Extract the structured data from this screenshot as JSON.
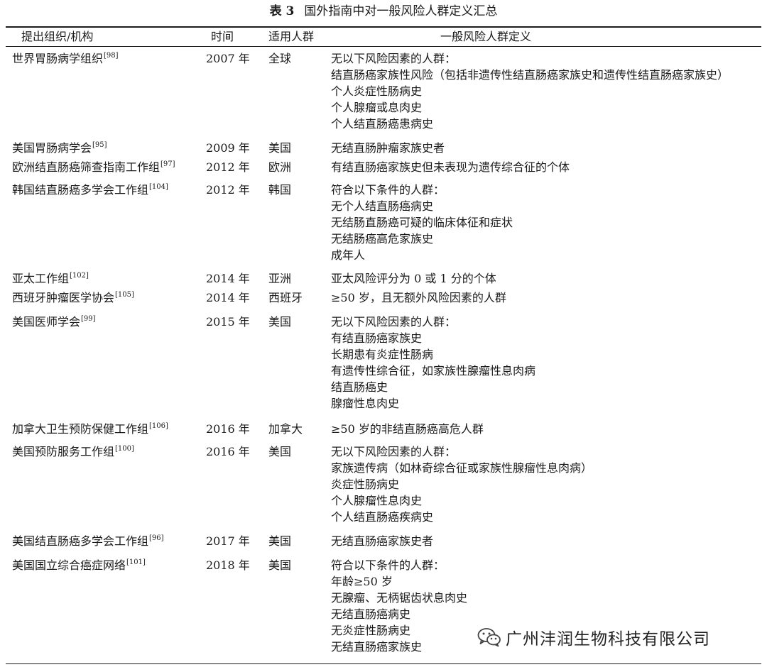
{
  "table": {
    "label": "表 3",
    "caption": "国外指南中对一般风险人群定义汇总",
    "headers": {
      "org": "提出组织/机构",
      "year": "时间",
      "scope": "适用人群",
      "definition": "一般风险人群定义"
    },
    "rows": [
      {
        "org": "世界胃肠病学组织",
        "ref": "[98]",
        "year": "2007 年",
        "scope": "全球",
        "defs": [
          "无以下风险因素的人群：",
          "结直肠癌家族性风险（包括非遗传性结直肠癌家族史和遗传性结直肠癌家族史）",
          "个人炎症性肠病史",
          "个人腺瘤或息肉史",
          "个人结直肠癌患病史"
        ]
      },
      {
        "org": "美国胃肠病学会",
        "ref": "[95]",
        "year": "2009 年",
        "scope": "美国",
        "defs": [
          "无结直肠肿瘤家族史者"
        ]
      },
      {
        "org": "欧洲结直肠癌筛查指南工作组",
        "ref": "[97]",
        "year": "2012 年",
        "scope": "欧洲",
        "defs": [
          "有结直肠癌家族史但未表现为遗传综合征的个体"
        ]
      },
      {
        "org": "韩国结直肠癌多学会工作组",
        "ref": "[104]",
        "year": "2012 年",
        "scope": "韩国",
        "defs": [
          "符合以下条件的人群：",
          "无个人结直肠癌病史",
          "无结肠直肠癌可疑的临床体征和症状",
          "无结肠癌高危家族史",
          "成年人"
        ]
      },
      {
        "org": "亚太工作组",
        "ref": "[102]",
        "year": "2014 年",
        "scope": "亚洲",
        "defs": [
          "亚太风险评分为 0 或 1 分的个体"
        ]
      },
      {
        "org": "西班牙肿瘤医学协会",
        "ref": "[105]",
        "year": "2014 年",
        "scope": "西班牙",
        "defs": [
          "≥50 岁，且无额外风险因素的人群"
        ]
      },
      {
        "org": "美国医师学会",
        "ref": "[99]",
        "year": "2015 年",
        "scope": "美国",
        "defs": [
          "无以下风险因素的人群：",
          "有结直肠癌家族史",
          "长期患有炎症性肠病",
          "有遗传性综合征，如家族性腺瘤性息肉病",
          "结直肠癌史",
          "腺瘤性息肉史"
        ]
      },
      {
        "org": "加拿大卫生预防保健工作组",
        "ref": "[106]",
        "year": "2016 年",
        "scope": "加拿大",
        "defs": [
          "≥50 岁的非结直肠癌高危人群"
        ]
      },
      {
        "org": "美国预防服务工作组",
        "ref": "[100]",
        "year": "2016 年",
        "scope": "美国",
        "defs": [
          "无以下风险因素的人群：",
          "家族遗传病（如林奇综合征或家族性腺瘤性息肉病）",
          "炎症性肠病史",
          "个人腺瘤性息肉史",
          "个人结直肠癌疾病史"
        ]
      },
      {
        "org": "美国结直肠癌多学会工作组",
        "ref": "[96]",
        "year": "2017 年",
        "scope": "美国",
        "defs": [
          "无结直肠癌家族史者"
        ]
      },
      {
        "org": "美国国立综合癌症网络",
        "ref": "[101]",
        "year": "2018 年",
        "scope": "美国",
        "defs": [
          "符合以下条件的人群：",
          "年龄≥50 岁",
          "无腺瘤、无柄锯齿状息肉史",
          "无结直肠癌病史",
          "无炎症性肠病史",
          "无结直肠癌家族史"
        ]
      }
    ]
  },
  "watermark": {
    "text": "广州沣润生物科技有限公司",
    "icon": "wechat-icon"
  }
}
